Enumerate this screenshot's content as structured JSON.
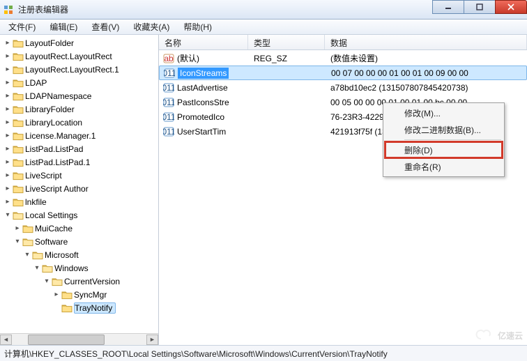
{
  "window": {
    "title": "注册表编辑器"
  },
  "menu": {
    "file": "文件(F)",
    "edit": "编辑(E)",
    "view": "查看(V)",
    "fav": "收藏夹(A)",
    "help": "帮助(H)"
  },
  "tree_top": [
    "LayoutFolder",
    "LayoutRect.LayoutRect",
    "LayoutRect.LayoutRect.1",
    "LDAP",
    "LDAPNamespace",
    "LibraryFolder",
    "LibraryLocation",
    "License.Manager.1",
    "ListPad.ListPad",
    "ListPad.ListPad.1",
    "LiveScript",
    "LiveScript Author",
    "lnkfile"
  ],
  "tree_local": {
    "label": "Local Settings",
    "muicache": "MuiCache",
    "software": "Software",
    "microsoft": "Microsoft",
    "windows": "Windows",
    "currentversion": "CurrentVersion",
    "syncmgr": "SyncMgr",
    "traynotify": "TrayNotify"
  },
  "cols": {
    "name": "名称",
    "type": "类型",
    "data": "数据"
  },
  "rows": [
    {
      "name": "(默认)",
      "type": "REG_SZ",
      "data": "(数值未设置)",
      "kind": "str"
    },
    {
      "name": "IconStreams",
      "type": "",
      "data": "00 07 00 00 00 01 00 01 00 09 00 00",
      "kind": "bin",
      "sel": true
    },
    {
      "name": "LastAdvertise",
      "type": "",
      "data": "a78bd10ec2 (131507807845420738)",
      "kind": "bin"
    },
    {
      "name": "PastIconsStre",
      "type": "",
      "data": "00 05 00 00 00 01 00 01 00 bc 00 00",
      "kind": "bin"
    },
    {
      "name": "PromotedIco",
      "type": "",
      "data": "76-23R3-4229-82P1-R41PO67Q5O9P}",
      "kind": "bin"
    },
    {
      "name": "UserStartTim",
      "type": "",
      "data": "421913f75f (131486481407801183)",
      "kind": "bin"
    }
  ],
  "ctx": {
    "modify": "修改(M)...",
    "modbin": "修改二进制数据(B)...",
    "delete": "删除(D)",
    "rename": "重命名(R)"
  },
  "status": "计算机\\HKEY_CLASSES_ROOT\\Local Settings\\Software\\Microsoft\\Windows\\CurrentVersion\\TrayNotify",
  "watermark": "亿速云"
}
